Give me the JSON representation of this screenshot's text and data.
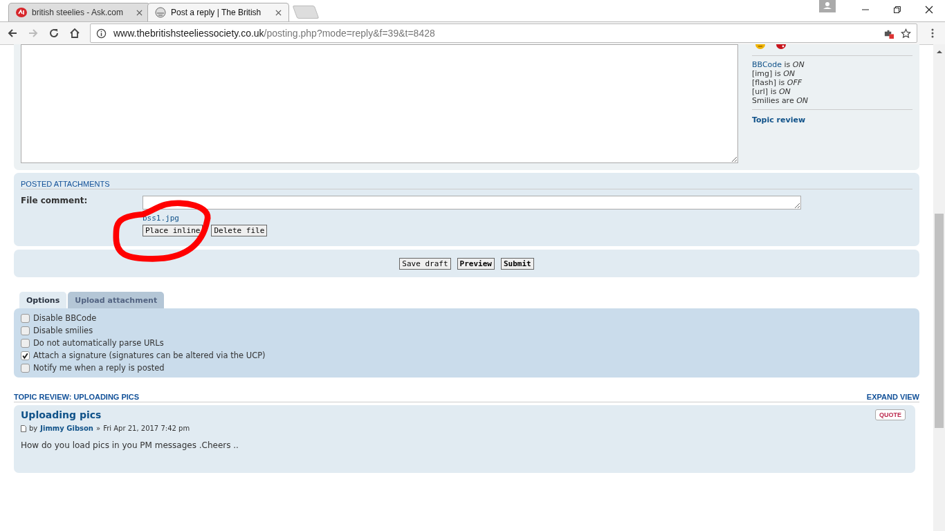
{
  "browser": {
    "tabs": [
      {
        "title": "british steelies - Ask.com",
        "selected": false,
        "kind": "ask"
      },
      {
        "title": "Post a reply | The British",
        "selected": true,
        "kind": "site"
      }
    ],
    "url": {
      "host": "www.thebritishsteeliessociety.co.uk",
      "path": "/posting.php?mode=reply&f=39&t=8428"
    }
  },
  "editor": {
    "status": [
      {
        "label": "BBCode",
        "link": true,
        "rest": "is *ON*"
      },
      {
        "label": "[img]",
        "link": false,
        "rest": "is *ON*"
      },
      {
        "label": "[flash]",
        "link": false,
        "rest": "is *OFF*"
      },
      {
        "label": "[url]",
        "link": false,
        "rest": "is *ON*"
      },
      {
        "label": "Smilies",
        "link": false,
        "rest": "are *ON*"
      }
    ],
    "topic_review_link": "Topic review"
  },
  "attachments": {
    "heading": "POSTED ATTACHMENTS",
    "comment_label": "File comment:",
    "file": "bss1.jpg",
    "buttons": [
      "Place inline",
      "Delete file"
    ]
  },
  "actions": [
    {
      "label": "Save draft",
      "primary": false
    },
    {
      "label": "Preview",
      "primary": true
    },
    {
      "label": "Submit",
      "primary": true
    }
  ],
  "tabs": [
    {
      "label": "Options",
      "selected": true
    },
    {
      "label": "Upload attachment",
      "selected": false
    }
  ],
  "options": [
    {
      "label": "Disable BBCode",
      "checked": false
    },
    {
      "label": "Disable smilies",
      "checked": false
    },
    {
      "label": "Do not automatically parse URLs",
      "checked": false
    },
    {
      "label": "Attach a signature (signatures can be altered via the UCP)",
      "checked": true
    },
    {
      "label": "Notify me when a reply is posted",
      "checked": false
    }
  ],
  "review": {
    "heading": "TOPIC REVIEW: UPLOADING PICS",
    "expand": "EXPAND VIEW",
    "post": {
      "title": "Uploading pics",
      "by": "by",
      "author": "Jimmy Gibson",
      "sep": "»",
      "date": "Fri Apr 21, 2017 7:42 pm",
      "quote": "QUOTE",
      "body": "How do you load pics in you PM messages .Cheers .."
    }
  }
}
